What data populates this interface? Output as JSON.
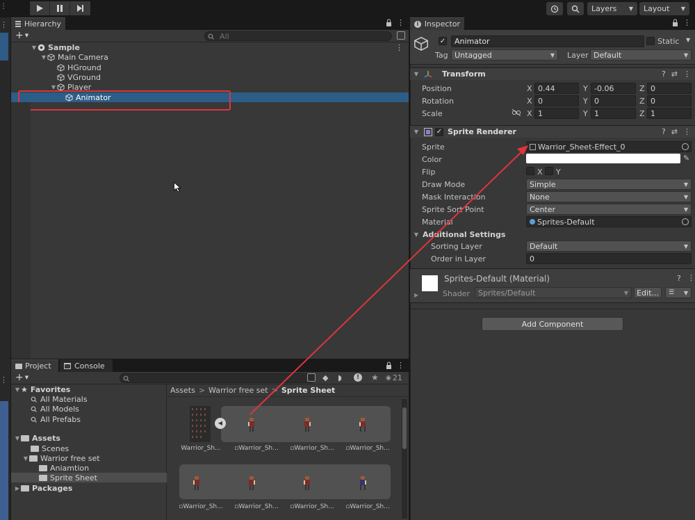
{
  "toolbar": {
    "layers_label": "Layers",
    "layout_label": "Layout",
    "icons": [
      "play-icon",
      "pause-icon",
      "step-icon",
      "history-icon",
      "search-icon"
    ]
  },
  "hierarchy": {
    "tab_label": "Hierarchy",
    "search_placeholder": "All",
    "scene_name": "Sample",
    "items": [
      {
        "label": "Main Camera"
      },
      {
        "label": "HGround"
      },
      {
        "label": "VGround"
      },
      {
        "label": "Player"
      },
      {
        "label": "Animator"
      }
    ]
  },
  "inspector": {
    "tab_label": "Inspector",
    "object_name": "Animator",
    "static_label": "Static",
    "tag_label": "Tag",
    "tag_value": "Untagged",
    "layer_label": "Layer",
    "layer_value": "Default",
    "transform": {
      "title": "Transform",
      "position_label": "Position",
      "rotation_label": "Rotation",
      "scale_label": "Scale",
      "axis_x": "X",
      "axis_y": "Y",
      "axis_z": "Z",
      "position": {
        "x": "0.44",
        "y": "-0.06",
        "z": "0"
      },
      "rotation": {
        "x": "0",
        "y": "0",
        "z": "0"
      },
      "scale": {
        "x": "1",
        "y": "1",
        "z": "1"
      }
    },
    "sprite_renderer": {
      "title": "Sprite Renderer",
      "sprite_label": "Sprite",
      "sprite_value": "Warrior_Sheet-Effect_0",
      "color_label": "Color",
      "color_value": "#ffffff",
      "flip_label": "Flip",
      "flip_x": "X",
      "flip_y": "Y",
      "draw_mode_label": "Draw Mode",
      "draw_mode_value": "Simple",
      "mask_label": "Mask Interaction",
      "mask_value": "None",
      "sort_point_label": "Sprite Sort Point",
      "sort_point_value": "Center",
      "material_label": "Material",
      "material_value": "Sprites-Default",
      "additional_label": "Additional Settings",
      "sorting_layer_label": "Sorting Layer",
      "sorting_layer_value": "Default",
      "order_label": "Order in Layer",
      "order_value": "0"
    },
    "material_block": {
      "title": "Sprites-Default (Material)",
      "shader_label": "Shader",
      "shader_value": "Sprites/Default",
      "edit_label": "Edit..."
    },
    "add_component_label": "Add Component"
  },
  "project": {
    "tab_project": "Project",
    "tab_console": "Console",
    "hidden_count": "21",
    "favorites_label": "Favorites",
    "favorites": [
      "All Materials",
      "All Models",
      "All Prefabs"
    ],
    "assets_label": "Assets",
    "tree": [
      "Scenes",
      "Warrior free set",
      "Aniamtion",
      "Sprite Sheet"
    ],
    "packages_label": "Packages",
    "breadcrumb": {
      "root": "Assets",
      "mid": "Warrior free set",
      "current": "Sprite Sheet"
    },
    "thumb_caption": "Warrior_Sh..."
  },
  "colors": {
    "selection": "#2c5d87",
    "annotation_red": "#e0353a",
    "panel_bg": "#383838"
  }
}
